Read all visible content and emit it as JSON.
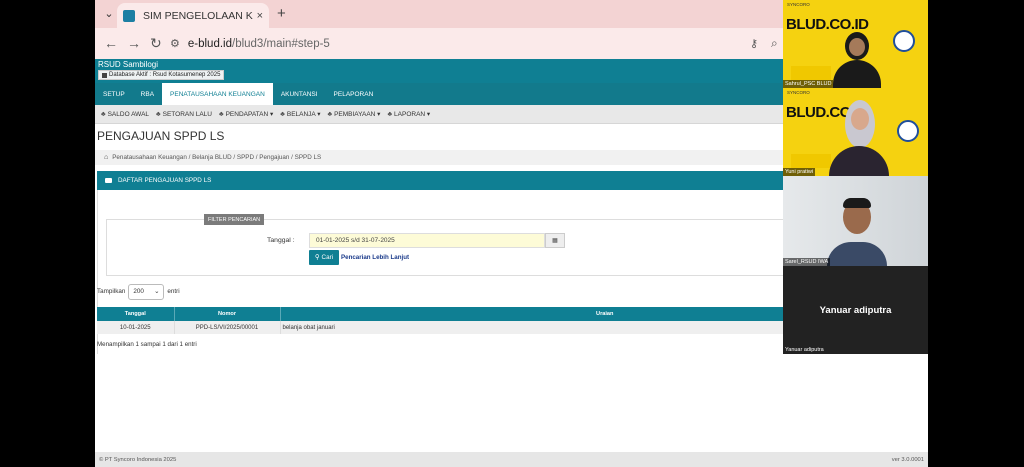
{
  "browser": {
    "tab_title": "SIM PENGELOLAAN KEUANGAN",
    "tab_close": "×",
    "new_tab": "+",
    "tab_menu": "⌄",
    "url_host": "e-blud.id",
    "url_path": "/blud3/main#step-5",
    "back": "←",
    "forward": "→",
    "reload": "↻"
  },
  "app": {
    "title": "RSUD Sambilogi",
    "db_badge": "Database Aktif : Rsud Kotasumenep 2025"
  },
  "main_nav": [
    "SETUP",
    "RBA",
    "PENATAUSAHAAN KEUANGAN",
    "AKUNTANSI",
    "PELAPORAN"
  ],
  "main_nav_active": 2,
  "sub_nav": [
    "SALDO AWAL",
    "SETORAN LALU",
    "PENDAPATAN ▾",
    "BELANJA ▾",
    "PEMBIAYAAN ▾",
    "LAPORAN ▾"
  ],
  "page": {
    "title": "PENGAJUAN SPPD LS",
    "breadcrumb": "Penatausahaan Keuangan / Belanja BLUD / SPPD / Pengajuan / SPPD LS"
  },
  "panel": {
    "title": "DAFTAR PENGAJUAN SPPD LS"
  },
  "filter": {
    "legend": "FILTER PENCARIAN",
    "tanggal_label": "Tanggal :",
    "tanggal_value": "01-01-2025 s/d 31-07-2025",
    "cari_label": "Cari",
    "lanjut_label": "Pencarian Lebih Lanjut"
  },
  "table_controls": {
    "show_prefix": "Tampilkan",
    "show_value": "200",
    "show_suffix": "entri",
    "info": "Menampilkan 1 sampai 1 dari 1 entri"
  },
  "table": {
    "columns": [
      "Tanggal",
      "Nomor",
      "Uraian"
    ],
    "rows": [
      [
        "10-01-2025",
        "PPD-LS/VI/2025/00001",
        "belanja obat januari"
      ]
    ]
  },
  "footer": {
    "left": "© PT Syncoro Indonesia 2025",
    "right": "ver 3.0.0001"
  },
  "video_tiles": [
    {
      "name": "Sahrul_PSC BLUD",
      "brand": "BLUD.CO.ID",
      "topline": "SYNCORO"
    },
    {
      "name": "Yuni pratiwi",
      "brand": "BLUD.CO",
      "topline": "SYNCORO"
    },
    {
      "name": "Sarel_RSUD IWA",
      "brand": "",
      "topline": ""
    },
    {
      "name": "Yanuar adiputra",
      "brand": "Yanuar adiputra",
      "topline": ""
    }
  ],
  "colors": {
    "teal": "#0f7f93",
    "tab_bg": "#f3d3d3",
    "tile_yellow": "#f5d210"
  }
}
